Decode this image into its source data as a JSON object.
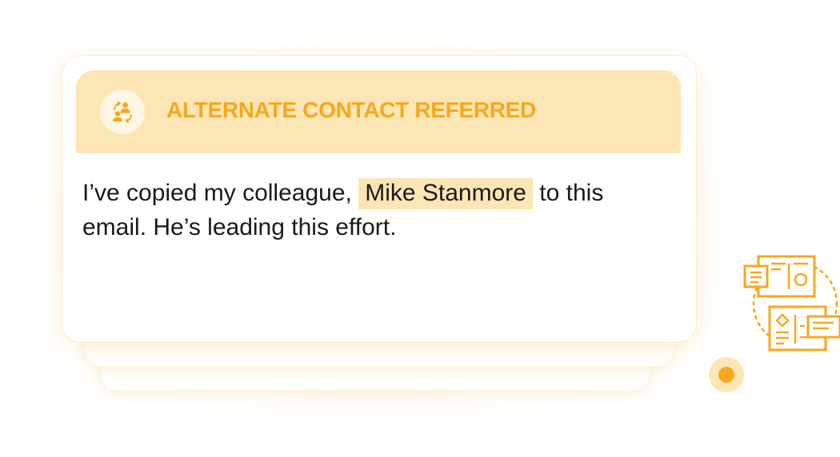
{
  "card": {
    "header_title": "ALTERNATE CONTACT REFERRED",
    "header_icon": "referral-people-icon",
    "message": {
      "before": "I’ve copied my colleague, ",
      "highlight": "Mike Stanmore",
      "after": " to this email. He’s leading this effort."
    }
  },
  "decorations": {
    "illustration_icon": "documents-exchange-icon",
    "indicator": "status-dot"
  },
  "colors": {
    "accent": "#f7a81b",
    "header_background": "#fde6b5",
    "highlight": "#fde6b5",
    "text": "#1a1a1a"
  }
}
